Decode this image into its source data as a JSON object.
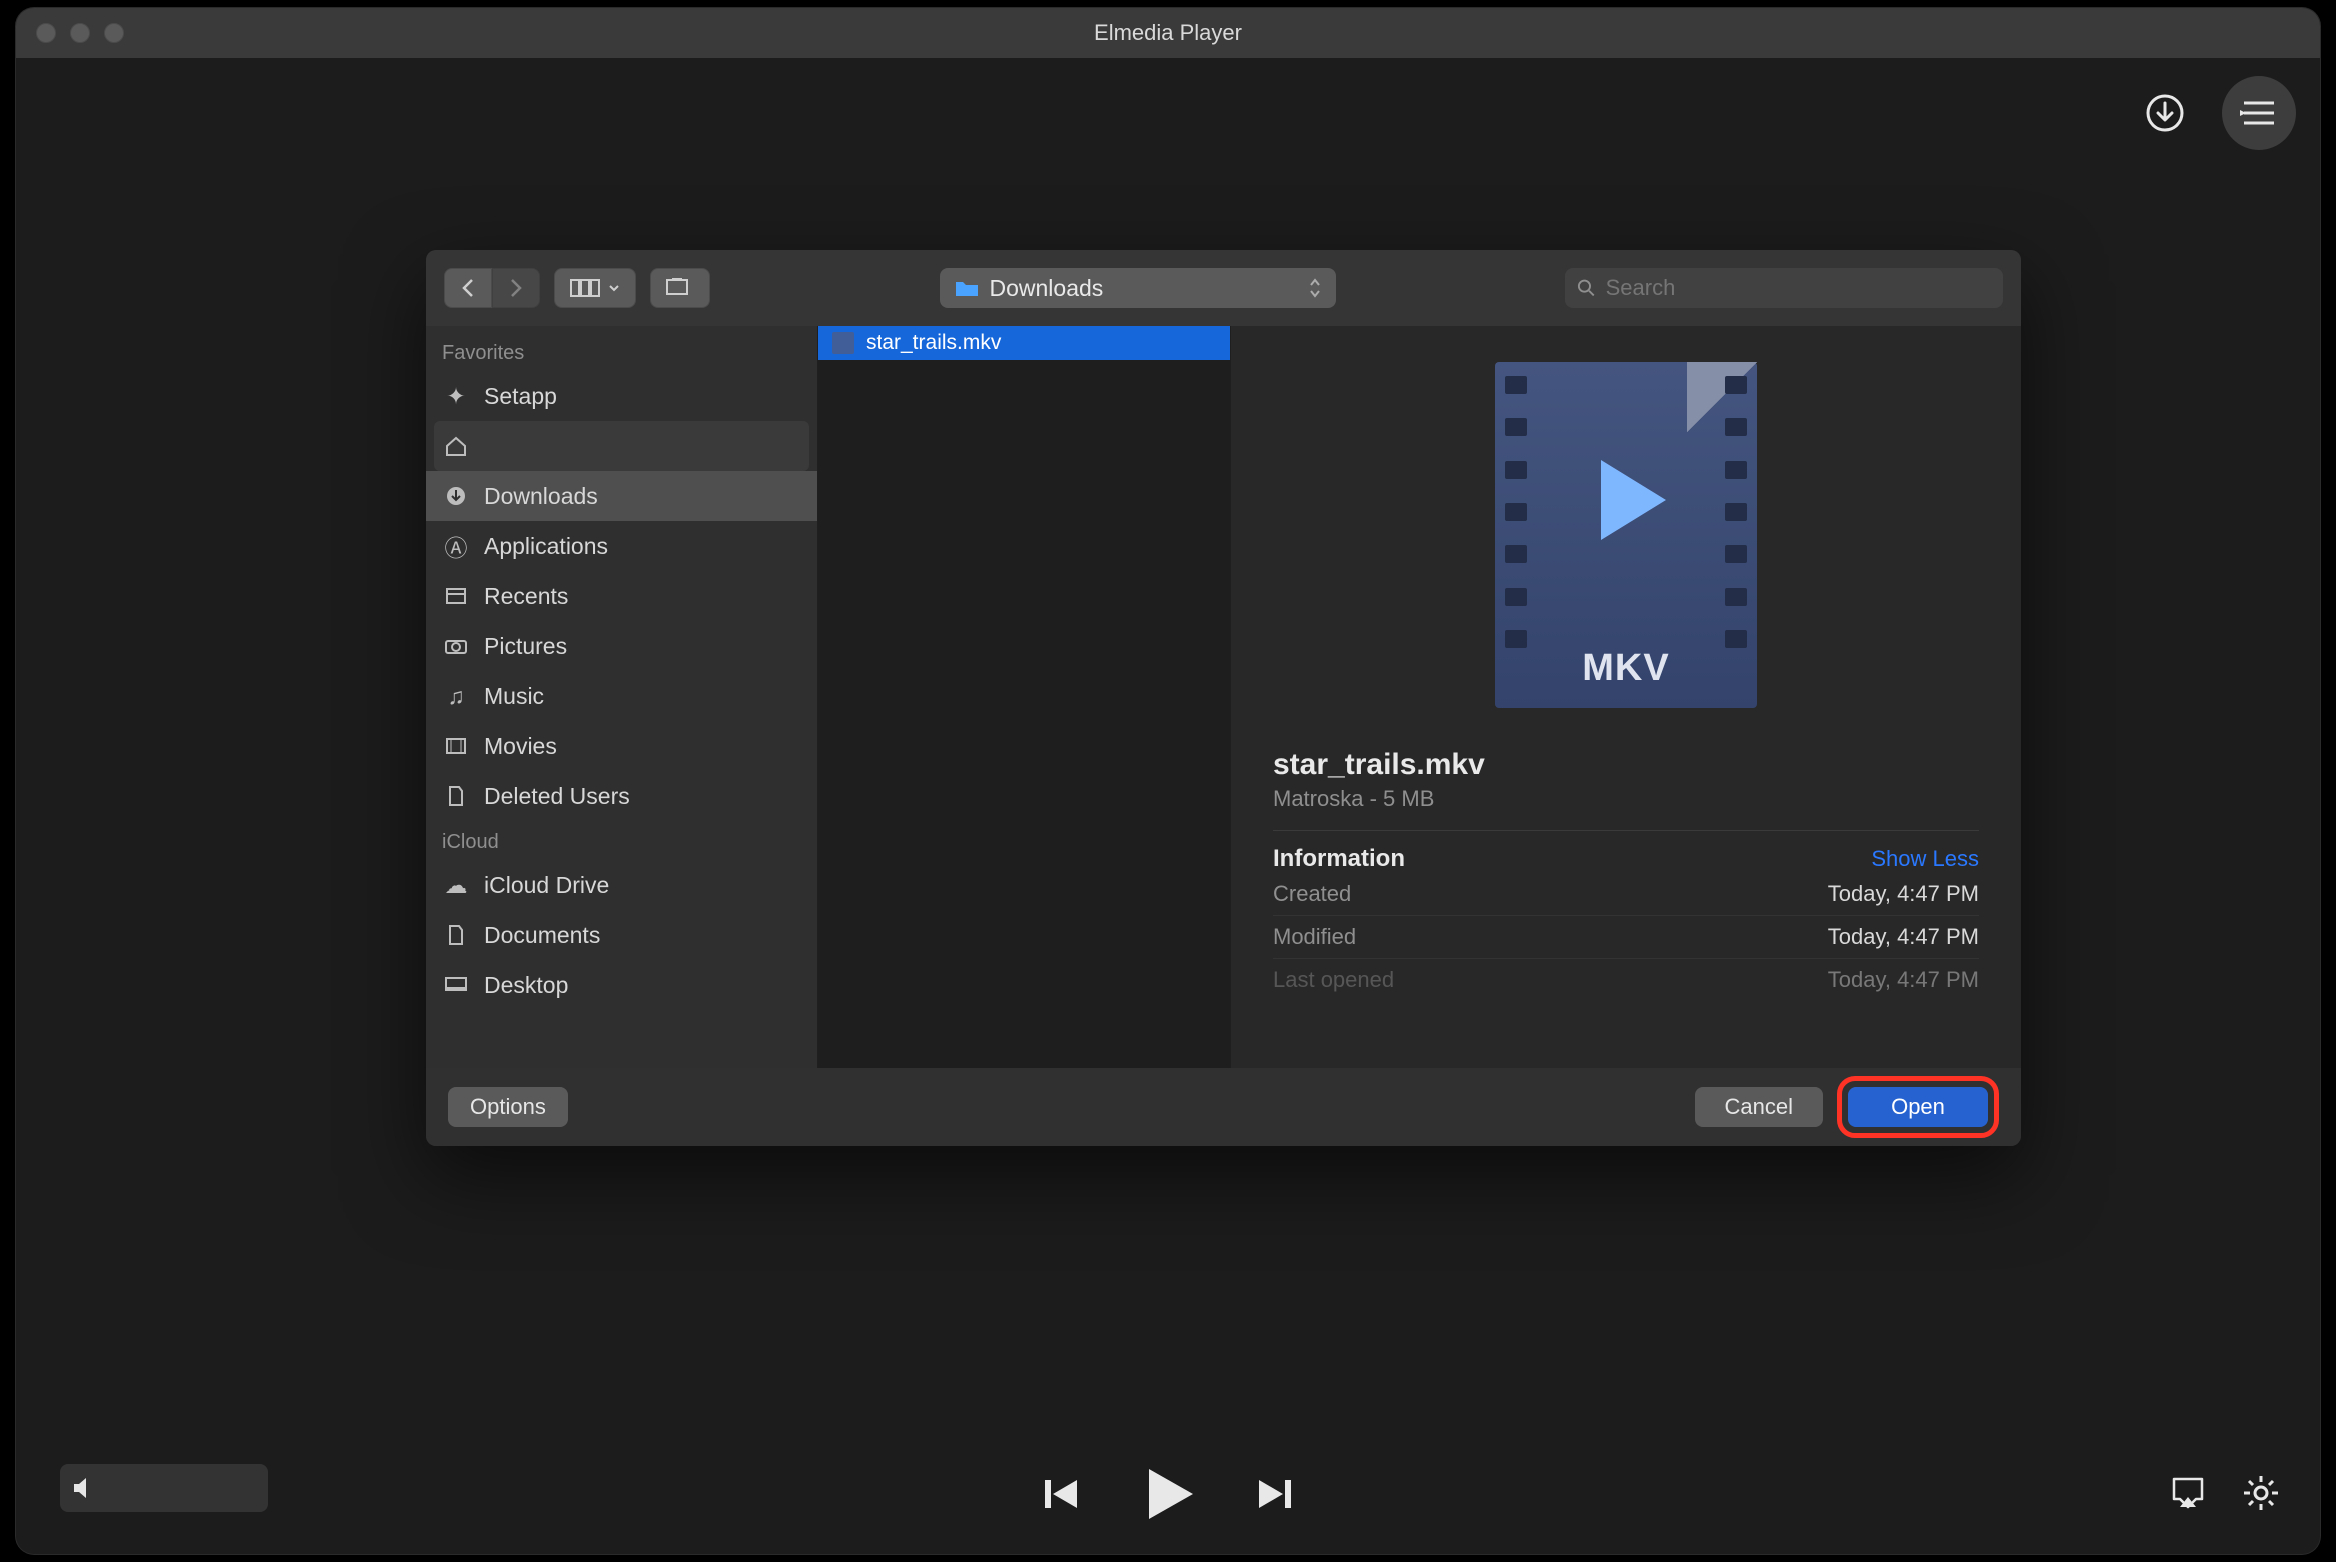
{
  "app": {
    "title": "Elmedia Player"
  },
  "dialog": {
    "location": "Downloads",
    "search_placeholder": "Search",
    "sidebar": {
      "sections": [
        {
          "header": "Favorites",
          "items": [
            {
              "icon": "setapp",
              "label": "Setapp"
            },
            {
              "icon": "home",
              "label": ""
            },
            {
              "icon": "download",
              "label": "Downloads",
              "selected": true
            },
            {
              "icon": "apps",
              "label": "Applications"
            },
            {
              "icon": "recents",
              "label": "Recents"
            },
            {
              "icon": "camera",
              "label": "Pictures"
            },
            {
              "icon": "music",
              "label": "Music"
            },
            {
              "icon": "movie",
              "label": "Movies"
            },
            {
              "icon": "doc",
              "label": "Deleted Users"
            }
          ]
        },
        {
          "header": "iCloud",
          "items": [
            {
              "icon": "cloud",
              "label": "iCloud Drive"
            },
            {
              "icon": "docs",
              "label": "Documents"
            },
            {
              "icon": "desktop",
              "label": "Desktop"
            }
          ]
        }
      ]
    },
    "files": [
      {
        "name": "star_trails.mkv",
        "selected": true
      }
    ],
    "preview": {
      "icon_label": "MKV",
      "name": "star_trails.mkv",
      "subtitle": "Matroska - 5 MB",
      "info_header": "Information",
      "show_less": "Show Less",
      "meta": [
        {
          "key": "Created",
          "value": "Today, 4:47 PM"
        },
        {
          "key": "Modified",
          "value": "Today, 4:47 PM"
        },
        {
          "key": "Last opened",
          "value": "Today, 4:47 PM",
          "faded": true
        }
      ]
    },
    "footer": {
      "options": "Options",
      "cancel": "Cancel",
      "open": "Open"
    }
  }
}
